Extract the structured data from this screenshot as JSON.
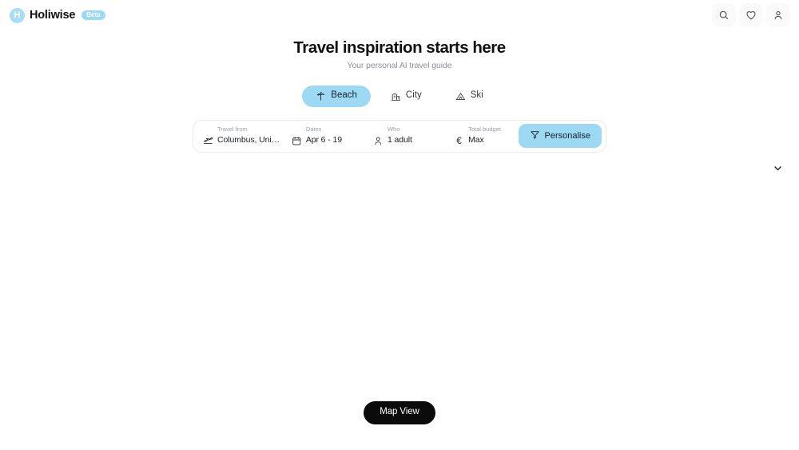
{
  "header": {
    "brand": {
      "mark_letter": "H",
      "name": "Holiwise",
      "badge": "Beta"
    },
    "actions": [
      {
        "name": "search-icon",
        "label": "Search"
      },
      {
        "name": "heart-icon",
        "label": "Saved"
      },
      {
        "name": "user-icon",
        "label": "Account"
      }
    ]
  },
  "hero": {
    "title": "Travel inspiration starts here",
    "subtitle": "Your personal AI travel guide"
  },
  "tabs": [
    {
      "label": "Beach",
      "icon": "palm-tree-icon",
      "active": true
    },
    {
      "label": "City",
      "icon": "building-icon",
      "active": false
    },
    {
      "label": "Ski",
      "icon": "mountain-icon",
      "active": false
    }
  ],
  "search": {
    "travel_from": {
      "label": "Travel from",
      "value": "Columbus, Unite...",
      "icon": "plane-departure-icon"
    },
    "dates": {
      "label": "Dates",
      "value": "Apr 6 - 19",
      "icon": "calendar-icon"
    },
    "who": {
      "label": "Who",
      "value": "1 adult",
      "icon": "person-icon"
    },
    "budget": {
      "label": "Total budget",
      "value": "Max",
      "icon": "euro-icon",
      "currency_glyph": "€"
    },
    "personalise": {
      "label": "Personalise",
      "icon": "filter-funnel-icon"
    }
  },
  "collapse": {
    "icon": "chevron-down-icon"
  },
  "map_view": {
    "label": "Map View"
  },
  "colors": {
    "accent": "#9ed9f4",
    "badge": "#9ed9f4",
    "dark_button": "#0b0b0b",
    "muted_text": "#8d9196",
    "panel_border": "#ececec"
  }
}
